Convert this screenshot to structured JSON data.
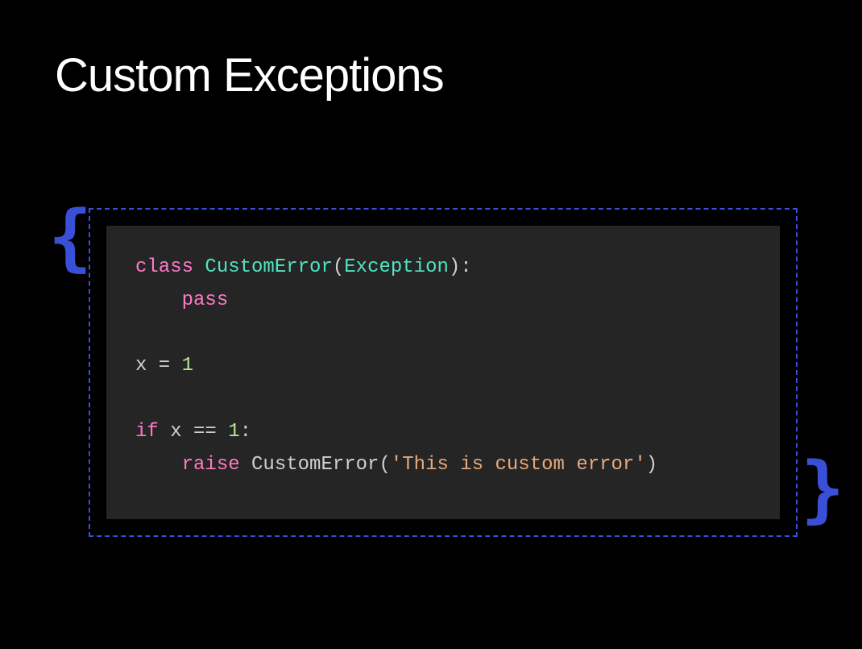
{
  "title": "Custom Exceptions",
  "decor": {
    "brace_left": "{",
    "brace_right": "}"
  },
  "code": {
    "line1": {
      "kw_class": "class",
      "cls_name": "CustomError",
      "lparen": "(",
      "base": "Exception",
      "rparen": ")",
      "colon": ":"
    },
    "line2": {
      "indent": "    ",
      "kw_pass": "pass"
    },
    "line3": {
      "var": "x",
      "eq": " = ",
      "num": "1"
    },
    "line4": {
      "kw_if": "if",
      "sp1": " ",
      "var": "x",
      "sp2": " ",
      "op": "==",
      "sp3": " ",
      "num": "1",
      "colon": ":"
    },
    "line5": {
      "indent": "    ",
      "kw_raise": "raise",
      "sp": " ",
      "call": "CustomError",
      "lparen": "(",
      "str": "'This is custom error'",
      "rparen": ")"
    }
  }
}
